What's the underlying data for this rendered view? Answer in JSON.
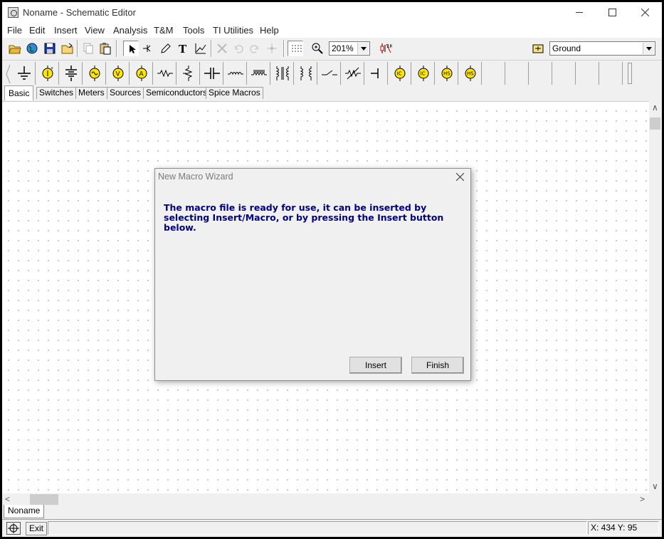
{
  "window": {
    "title": "Noname - Schematic Editor"
  },
  "menu": [
    "File",
    "Edit",
    "Insert",
    "View",
    "Analysis",
    "T&M",
    "Tools",
    "TI Utilities",
    "Help"
  ],
  "toolbar": {
    "zoom": "201%",
    "component": "Ground"
  },
  "component_tabs": [
    "Basic",
    "Switches",
    "Meters",
    "Sources",
    "Semiconductors",
    "Spice Macros"
  ],
  "part_labels": {
    "ic1": "IC",
    "ic2": "IC",
    "hs1": "HS",
    "hs2": "HS"
  },
  "dialog": {
    "title": "New Macro Wizard",
    "message": "The macro file is ready for use, it can be inserted by selecting Insert/Macro, or by pressing the Insert button below.",
    "insert_label": "Insert",
    "finish_label": "Finish"
  },
  "doc_tab": "Noname",
  "status": {
    "exit_label": "Exit",
    "coords": "X: 434  Y: 95"
  }
}
